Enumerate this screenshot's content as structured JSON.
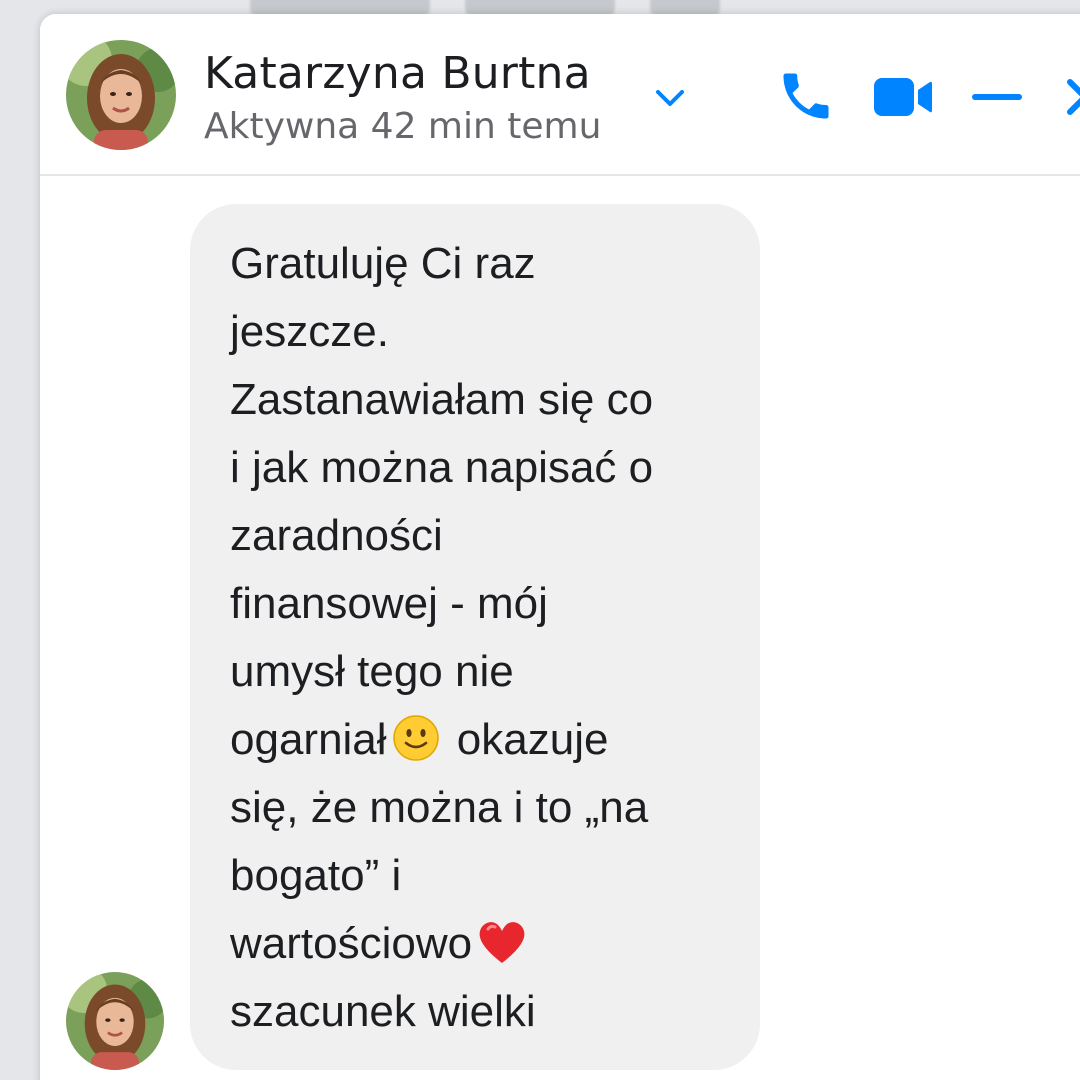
{
  "chat_header": {
    "contact_name": "Katarzyna Burtna",
    "contact_status": "Aktywna 42 min temu",
    "icons": {
      "expand": "chevron-down-icon",
      "call": "phone-icon",
      "video": "video-camera-icon",
      "minimize": "minimize-icon",
      "close": "close-icon"
    },
    "accent_color": "#0084ff"
  },
  "message": {
    "sender": "Katarzyna Burtna",
    "text_part1": "Gratuluję Ci raz\njeszcze.\nZastanawiałam się co\ni jak można napisać o\nzaradności\nfinansowej - mój\numysł tego nie\nogarniał",
    "emoji1": "slightly-smiling-face-emoji",
    "text_part2": " okazuje\nsię, że można i to „na\nbogato” i\nwartościowo",
    "emoji2": "red-heart-emoji",
    "text_part3": "\nszacunek wielki",
    "bubble_color": "#f0f0f0"
  }
}
